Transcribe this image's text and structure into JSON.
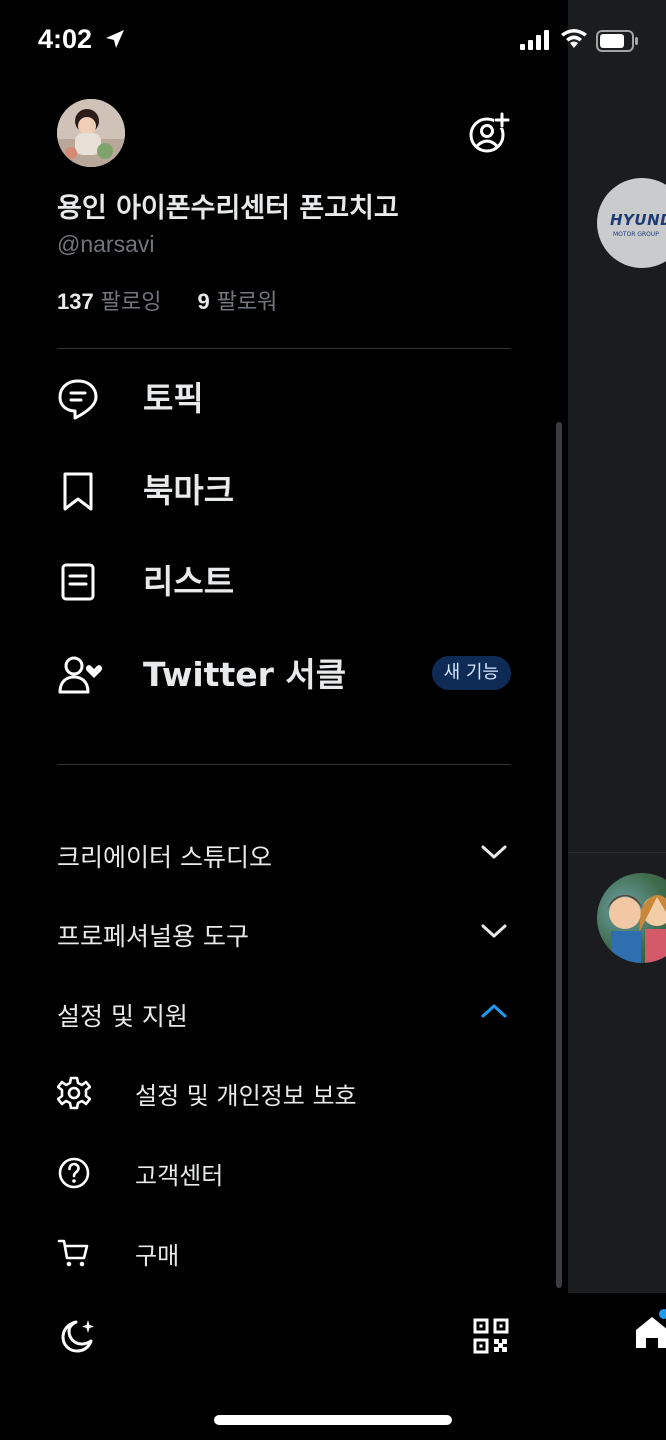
{
  "status_bar": {
    "time": "4:02"
  },
  "profile": {
    "display_name": "용인 아이폰수리센터 폰고치고",
    "handle": "@narsavi",
    "following_count": "137",
    "following_label": "팔로잉",
    "followers_count": "9",
    "followers_label": "팔로워"
  },
  "nav": {
    "items": [
      {
        "label": "토픽",
        "icon": "topics-icon"
      },
      {
        "label": "북마크",
        "icon": "bookmark-icon"
      },
      {
        "label": "리스트",
        "icon": "lists-icon"
      },
      {
        "label": "Twitter 서클",
        "icon": "circle-people-heart-icon",
        "badge": "새 기능"
      }
    ]
  },
  "sections": {
    "creator_studio": {
      "label": "크리에이터 스튜디오",
      "expanded": false
    },
    "professional_tools": {
      "label": "프로페셔널용 도구",
      "expanded": false
    },
    "settings_support": {
      "label": "설정 및 지원",
      "expanded": true,
      "items": [
        {
          "label": "설정 및 개인정보 보호",
          "icon": "gear-icon"
        },
        {
          "label": "고객센터",
          "icon": "help-circle-icon"
        },
        {
          "label": "구매",
          "icon": "cart-icon"
        }
      ]
    }
  },
  "colors": {
    "background": "#000000",
    "text_primary": "#e7e9ea",
    "text_secondary": "#71767b",
    "accent": "#1d9bf0",
    "badge_bg": "#0e2b55"
  },
  "background_timeline": {
    "avatar_1_text": "HYUNDAI",
    "avatar_1_subtext": "MOTOR GROUP"
  }
}
